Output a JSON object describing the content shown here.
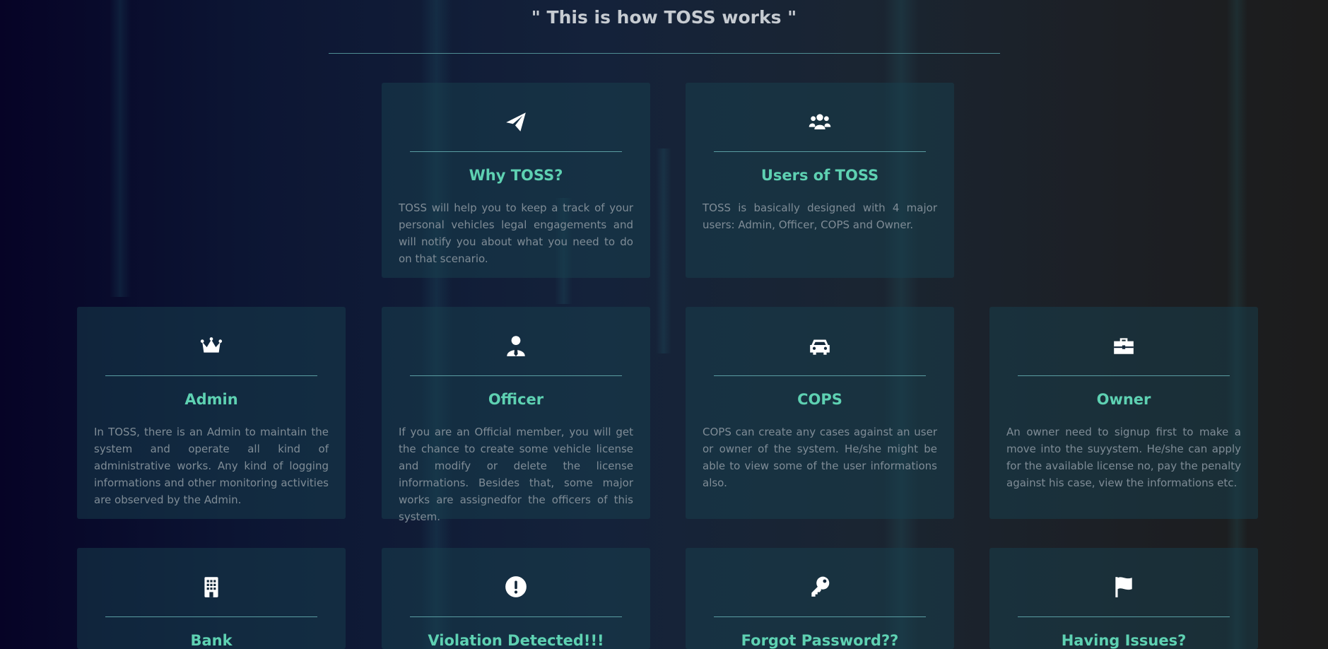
{
  "page": {
    "title": "\" This is how TOSS works \""
  },
  "colors": {
    "card_title": "#5ed1b2",
    "card_text": "#7f8c96",
    "rule": "#4f8d93",
    "icon": "#ffffff"
  },
  "cards": [
    {
      "icon": "paper-plane-icon",
      "title": "Why TOSS?",
      "text": "TOSS will help you to keep a track of your personal vehicles legal engagements and will notify you about what you need to do on that scenario."
    },
    {
      "icon": "users-icon",
      "title": "Users of TOSS",
      "text": "TOSS is basically designed with 4 major users: Admin, Officer, COPS and Owner."
    },
    {
      "icon": "crown-icon",
      "title": "Admin",
      "text": "In TOSS, there is an Admin to maintain the system and operate all kind of administrative works. Any kind of logging informations and other monitoring activities are observed by the Admin."
    },
    {
      "icon": "user-tie-icon",
      "title": "Officer",
      "text": "If you are an Official member, you will get the chance to create some vehicle license and modify or delete the license informations. Besides that, some major works are assignedfor the officers of this system."
    },
    {
      "icon": "car-icon",
      "title": "COPS",
      "text": "COPS can create any cases against an user or owner of the system. He/she might be able to view some of the user informations also."
    },
    {
      "icon": "briefcase-icon",
      "title": "Owner",
      "text": "An owner need to signup first to make a move into the suyystem. He/she can apply for the available license no, pay the penalty against his case, view the informations etc."
    },
    {
      "icon": "building-icon",
      "title": "Bank",
      "text": ""
    },
    {
      "icon": "exclamation-circle-icon",
      "title": "Violation Detected!!!",
      "text": ""
    },
    {
      "icon": "key-icon",
      "title": "Forgot Password??",
      "text": ""
    },
    {
      "icon": "flag-icon",
      "title": "Having Issues?",
      "text": ""
    }
  ]
}
